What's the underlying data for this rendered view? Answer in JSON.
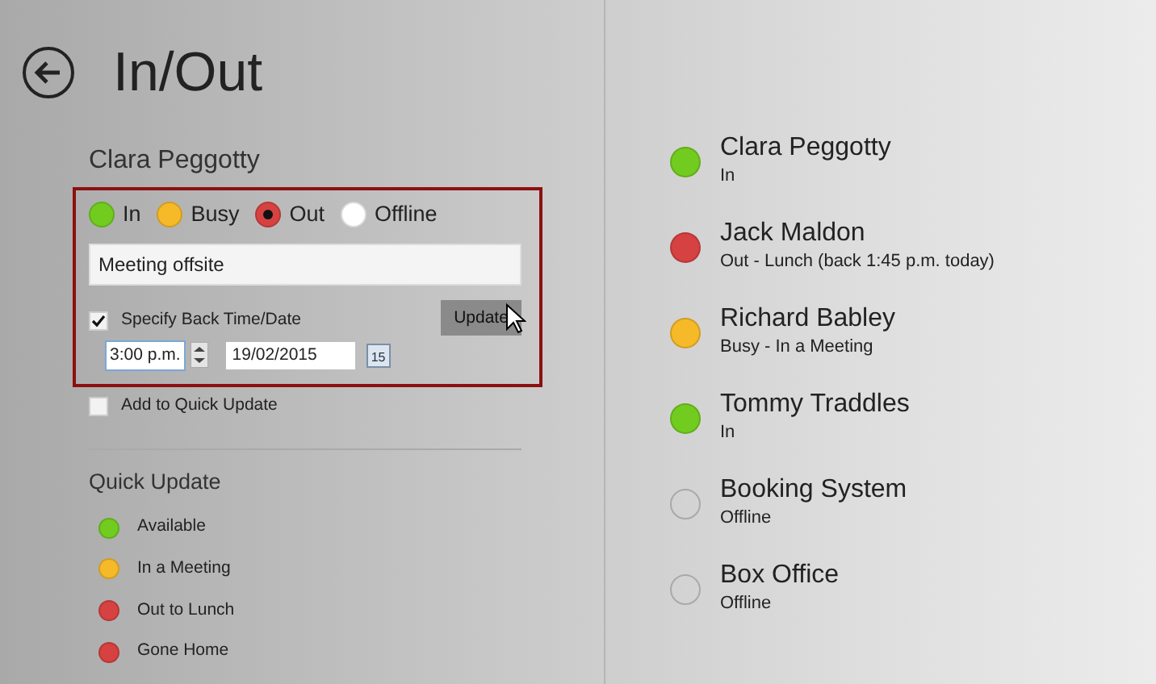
{
  "page": {
    "title": "In/Out"
  },
  "editor": {
    "name": "Clara Peggotty",
    "statuses": [
      {
        "label": "In",
        "color": "#72cc1f",
        "selected": false
      },
      {
        "label": "Busy",
        "color": "#f6b928",
        "selected": false
      },
      {
        "label": "Out",
        "color": "#d64141",
        "selected": true
      },
      {
        "label": "Offline",
        "color": "#ffffff",
        "selected": false
      }
    ],
    "message": "Meeting offsite",
    "specify_back": {
      "label": "Specify Back Time/Date",
      "checked": true
    },
    "time": "3:00 p.m.",
    "date": "19/02/2015",
    "calendar_day": "15",
    "update_button": "Update",
    "add_quick": {
      "label": "Add to Quick Update",
      "checked": false
    }
  },
  "quick_update": {
    "title": "Quick Update",
    "items": [
      {
        "label": "Available",
        "color": "#72cc1f"
      },
      {
        "label": "In a Meeting",
        "color": "#f6b928"
      },
      {
        "label": "Out to Lunch",
        "color": "#d64141"
      },
      {
        "label": "Gone Home",
        "color": "#d64141"
      }
    ]
  },
  "contacts": [
    {
      "name": "Clara Peggotty",
      "status": "In",
      "online": true,
      "color": "#72cc1f"
    },
    {
      "name": "Jack Maldon",
      "status": "Out - Lunch (back 1:45 p.m. today)",
      "online": true,
      "color": "#d64141"
    },
    {
      "name": "Richard Babley",
      "status": "Busy - In a Meeting",
      "online": true,
      "color": "#f6b928"
    },
    {
      "name": "Tommy Traddles",
      "status": "In",
      "online": true,
      "color": "#72cc1f"
    },
    {
      "name": "Booking System",
      "status": "Offline",
      "online": false,
      "color": "#a9a9a9"
    },
    {
      "name": "Box Office",
      "status": "Offline",
      "online": false,
      "color": "#a9a9a9"
    }
  ]
}
